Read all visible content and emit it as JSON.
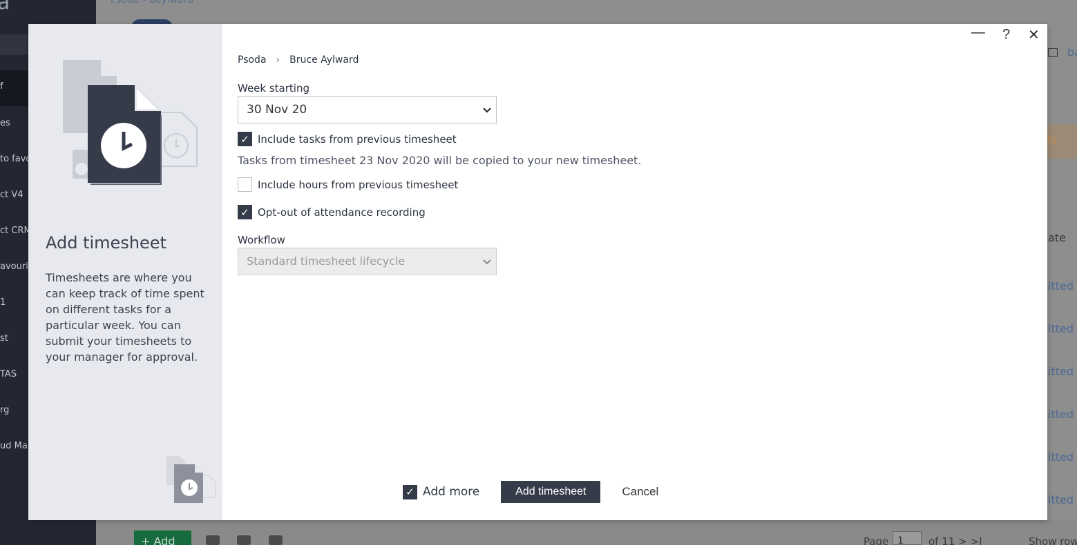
{
  "background": {
    "logo_glyph": "a",
    "crumb": "Psoda    ›  baylward",
    "nav_items": [
      "f",
      "es",
      "to favo",
      "ct V4",
      "ct CRM",
      "avourit",
      "1",
      "st",
      "TAS",
      "rg",
      "ud Mar"
    ],
    "right_texts": [
      "ba",
      "ate",
      "itted",
      "itted",
      "itted",
      "itted",
      "itted",
      "itted"
    ],
    "orange_tab": "ts",
    "add_button": "+ Add",
    "pager_page": "Page",
    "pager_value": "1",
    "pager_of": "of 11  >  >|",
    "show_rows": "Show row"
  },
  "modal": {
    "heading": "Add timesheet",
    "description": "Timesheets are where you can keep track of time spent on different tasks for a particular week. You can submit your timesheets to your manager for approval.",
    "window_controls": {
      "minimize": "—",
      "help": "?",
      "close": "✕"
    },
    "breadcrumb": {
      "root": "Psoda",
      "separator": "›",
      "current": "Bruce Aylward"
    },
    "week_starting": {
      "label": "Week starting",
      "value": "30 Nov 20"
    },
    "include_tasks": {
      "label": "Include tasks from previous timesheet",
      "checked": true
    },
    "info_text": "Tasks from timesheet 23 Nov 2020 will be copied to your new timesheet.",
    "include_hours": {
      "label": "Include hours from previous timesheet",
      "checked": false
    },
    "opt_out": {
      "label": "Opt-out of attendance recording",
      "checked": true
    },
    "workflow": {
      "label": "Workflow",
      "value": "Standard timesheet lifecycle"
    },
    "footer": {
      "add_more": {
        "label": "Add more",
        "checked": true
      },
      "submit_label": "Add timesheet",
      "cancel_label": "Cancel"
    },
    "check_glyph": "✓",
    "chevron_glyph": "⌄"
  },
  "colors": {
    "primary": "#363b4a",
    "panel_bg": "#e7e9ef",
    "sidebar_bg": "#232731",
    "add_green": "#176c3e"
  },
  "icons": [
    "timesheet-document-icon",
    "clock-icon",
    "chevron-down-icon",
    "check-icon",
    "close-icon",
    "minimize-icon",
    "help-icon"
  ]
}
